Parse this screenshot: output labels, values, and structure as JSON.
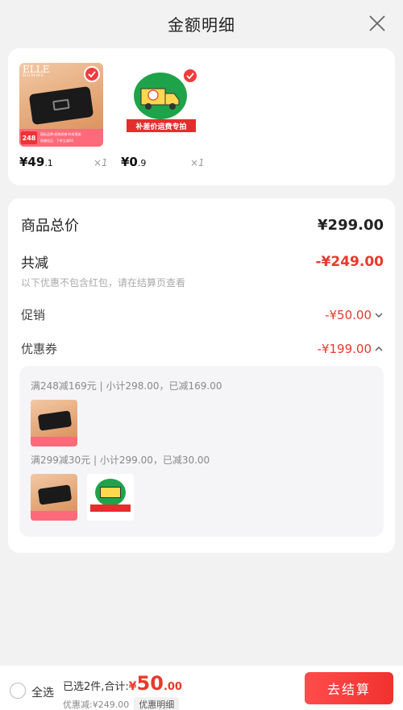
{
  "header": {
    "title": "金额明细"
  },
  "products": [
    {
      "brand": "ELLE",
      "brand_sub": "HOMME",
      "badge_price": "248",
      "tag_line1": "国际品牌·经典质感·时尚潮流",
      "tag_line2": "质感佳品 · 下单立减50",
      "price_int": "¥49",
      "price_dec": ".1",
      "qty": "×1",
      "selected": true
    },
    {
      "tag": "补差价运费专拍",
      "price_int": "¥0",
      "price_dec": ".9",
      "qty": "×1",
      "selected": true
    }
  ],
  "summary": {
    "total_label": "商品总价",
    "total_value": "¥299.00",
    "discount_label": "共减",
    "discount_value": "-¥249.00",
    "discount_note": "以下优惠不包含红包，请在结算页查看",
    "promo_label": "促销",
    "promo_value": "-¥50.00",
    "coupon_label": "优惠券",
    "coupon_value": "-¥199.00"
  },
  "coupon_details": [
    {
      "text": "满248减169元 | 小计298.00，已减169.00"
    },
    {
      "text": "满299减30元 | 小计299.00，已减30.00"
    }
  ],
  "bottom": {
    "select_all": "全选",
    "selected_text": "已选2件,合计:",
    "yen": "¥",
    "amount_int": "50",
    "amount_dec": ".00",
    "discount_text": "优惠减:¥249.00",
    "detail_chip": "优惠明细",
    "checkout_label": "去结算"
  },
  "colors": {
    "accent": "#e8392b",
    "checkout": "#f0322e",
    "badge_green": "#1fa34a"
  }
}
